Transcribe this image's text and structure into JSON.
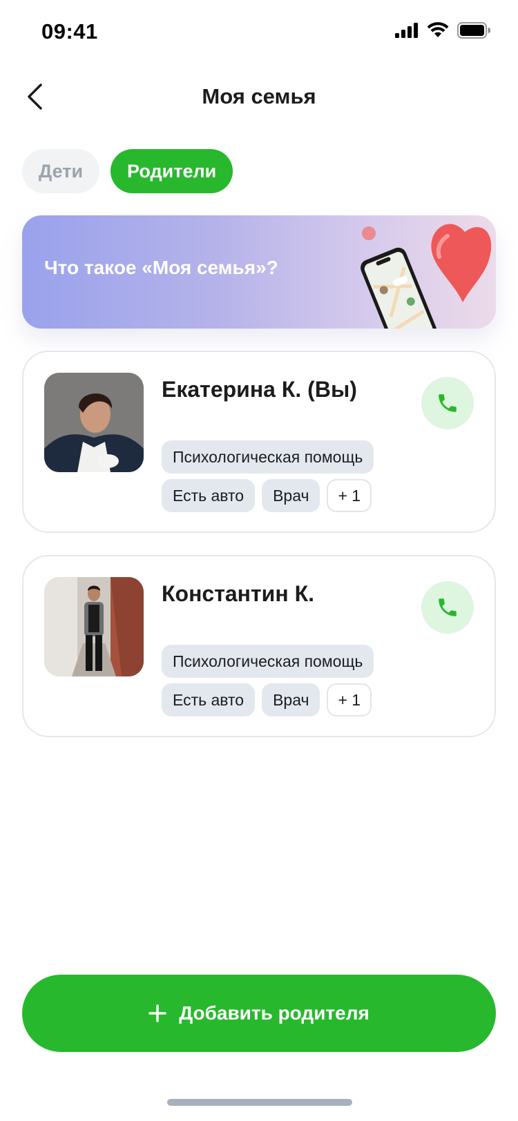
{
  "status_bar": {
    "time": "09:41"
  },
  "header": {
    "title": "Моя семья"
  },
  "tabs": [
    {
      "label": "Дети",
      "active": false
    },
    {
      "label": "Родители",
      "active": true
    }
  ],
  "banner": {
    "text": "Что такое «Моя семья»?"
  },
  "members": [
    {
      "name": "Екатерина К. (Вы)",
      "tags": [
        "Психологическая помощь",
        "Есть авто",
        "Врач"
      ],
      "more": "+ 1"
    },
    {
      "name": "Константин К.",
      "tags": [
        "Психологическая помощь",
        "Есть авто",
        "Врач"
      ],
      "more": "+ 1"
    }
  ],
  "add_button": {
    "label": "Добавить родителя",
    "icon": "plus-icon"
  },
  "icons": {
    "back": "chevron-left-icon",
    "call": "phone-icon",
    "signal": "cellular-signal-icon",
    "wifi": "wifi-icon",
    "battery": "battery-icon"
  },
  "colors": {
    "accent": "#27b82d",
    "call_bg": "#def5df",
    "tag_bg": "#e3e8ef",
    "inactive_tab_bg": "#f1f3f4"
  }
}
